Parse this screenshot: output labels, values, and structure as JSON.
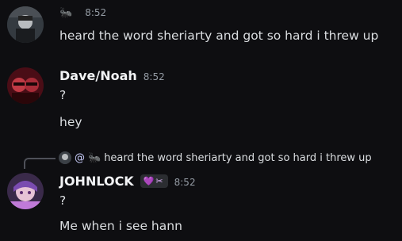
{
  "messages": [
    {
      "username": "",
      "time": "8:52",
      "lines": [
        "heard the word sheriarty and got so hard i threw up"
      ]
    },
    {
      "username": "Dave/Noah",
      "time": "8:52",
      "lines": [
        "?",
        "hey"
      ]
    },
    {
      "reply": {
        "mention": "@",
        "text": "heard the word sheriarty and got so hard i threw up"
      },
      "username": "JOHNLOCK",
      "badge_text": "",
      "time": "8:52",
      "lines": [
        "?",
        "Me when i see hann"
      ]
    }
  ],
  "colors": {
    "background": "#0e0e11",
    "username": "#f2f3f5",
    "timestamp": "#949ba4",
    "text": "#dbdee1"
  },
  "icons": [
    "ant-icon",
    "heart-icon",
    "ninja-star-icon",
    "reply-icon"
  ]
}
